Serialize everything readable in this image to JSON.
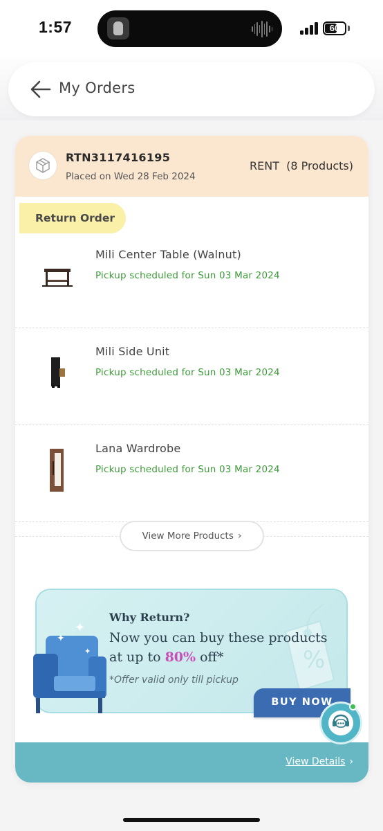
{
  "status_bar": {
    "time": "1:57",
    "battery": "60",
    "battery_level": 0.6
  },
  "header": {
    "title": "My Orders",
    "back_icon": "arrow-left-icon"
  },
  "order": {
    "id": "RTN3117416195",
    "placed": "Placed on Wed 28 Feb 2024",
    "type": "RENT  (8 Products)",
    "badge": "Return Order",
    "products": [
      {
        "name": "Mili Center Table (Walnut)",
        "status": "Pickup scheduled for Sun 03 Mar 2024",
        "icon": "center-table-icon"
      },
      {
        "name": "Mili Side Unit",
        "status": "Pickup scheduled for Sun 03 Mar 2024",
        "icon": "side-unit-icon"
      },
      {
        "name": "Lana Wardrobe",
        "status": "Pickup scheduled for Sun 03 Mar 2024",
        "icon": "wardrobe-icon"
      }
    ],
    "view_more": "View More Products",
    "footer_link": "View Details"
  },
  "promo": {
    "question": "Why Return?",
    "line1": "Now you can buy these products",
    "line2_pre": "at up to ",
    "line2_pct": "80%",
    "line2_post": " off*",
    "note": "*Offer valid only till pickup",
    "cta": "BUY NOW"
  },
  "colors": {
    "header_band": "#fbe6cf",
    "badge": "#faf0a8",
    "status_green": "#3e9a3a",
    "promo_accent": "#c94fb8",
    "cta": "#3b6bb0",
    "footer": "#68b8c4"
  }
}
